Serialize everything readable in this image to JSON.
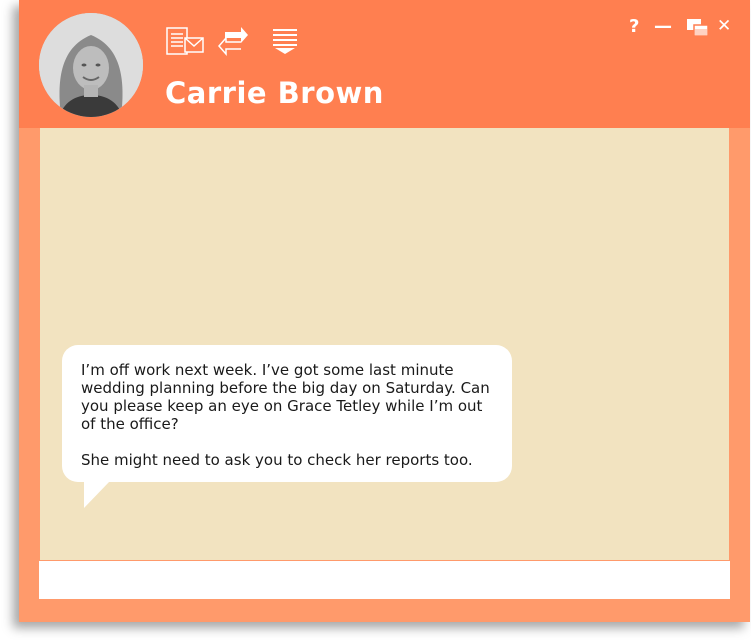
{
  "contact": {
    "name": "Carrie Brown",
    "avatar_icon": "contact-photo"
  },
  "toolbar": {
    "icons": [
      "email-icon",
      "transfer-icon",
      "menu-dropdown-icon"
    ]
  },
  "window_controls": {
    "help_label": "?",
    "minimize_label": "—",
    "close_label": "✕",
    "restore_icon": "restore-window-icon"
  },
  "messages": [
    {
      "from": "Carrie Brown",
      "text": "I’m off work next week. I’ve got some last minute wedding planning before the big day on Saturday. Can you please keep an eye on Grace Tetley while I’m out of the office?\n\nShe might need to ask you to check her reports too."
    }
  ],
  "compose": {
    "value": "",
    "placeholder": ""
  },
  "colors": {
    "header": "#FF7F50",
    "frame": "#FF9A6B",
    "chat_background": "#F2E3C0",
    "bubble": "#FFFFFF",
    "text_on_header": "#FFFFFF"
  }
}
